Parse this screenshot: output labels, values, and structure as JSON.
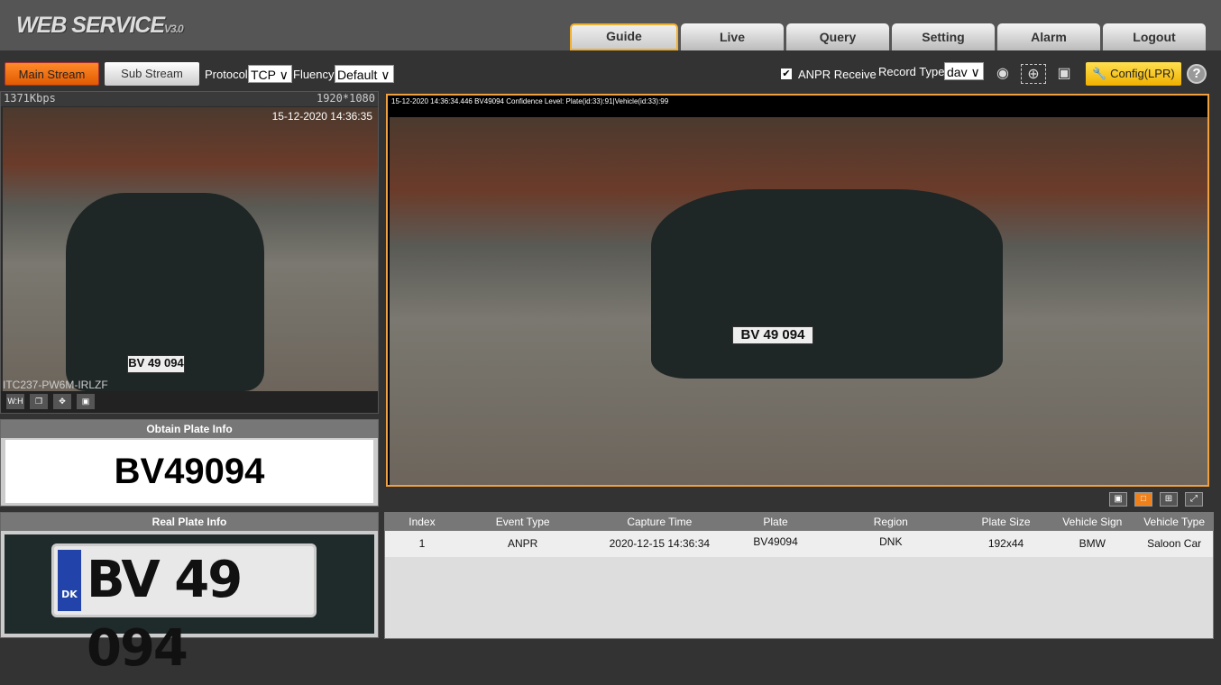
{
  "header": {
    "logo": "WEB  SERVICE",
    "version": "V3.0",
    "tabs": [
      {
        "label": "Guide",
        "active": true
      },
      {
        "label": "Live"
      },
      {
        "label": "Query"
      },
      {
        "label": "Setting"
      },
      {
        "label": "Alarm"
      },
      {
        "label": "Logout"
      }
    ]
  },
  "toolbar": {
    "main_stream": "Main Stream",
    "sub_stream": "Sub Stream",
    "protocol_label": "Protocol",
    "protocol": "TCP",
    "fluency_label": "Fluency",
    "fluency": "Default",
    "anpr_receive": "ANPR Receive",
    "anpr_checked": true,
    "record_type_label": "Record Type",
    "record_type": "dav",
    "config": "Config(LPR)",
    "help": "?"
  },
  "left_video": {
    "bitrate": "1371Kbps",
    "resolution": "1920*1080",
    "timestamp": "15-12-2020 14:36:35",
    "camera_name": "ITC237-PW6M-IRLZF",
    "plate": "BV 49 094",
    "controls": [
      "W:H",
      "window-icon",
      "ptz-icon",
      "fullscreen-icon"
    ]
  },
  "obtain_plate": {
    "title": "Obtain Plate Info",
    "plate": "BV49094"
  },
  "real_plate": {
    "title": "Real Plate Info",
    "plate": "BV 49 094",
    "country": "DK"
  },
  "main_video": {
    "caption": "15-12-2020 14:36:34.446 BV49094 Confidence Level: Plate(id:33):91|Vehicle(id:33):99",
    "plate": "BV 49 094",
    "accent": "#f0a040"
  },
  "table": {
    "columns": [
      "Index",
      "Event Type",
      "Capture Time",
      "Plate",
      "Region",
      "Plate Size",
      "Vehicle Sign",
      "Vehicle Type"
    ],
    "rows": [
      [
        "1",
        "ANPR",
        "2020-12-15 14:36:34",
        "BV49094",
        "DNK",
        "192x44",
        "BMW",
        "Saloon Car"
      ]
    ]
  }
}
